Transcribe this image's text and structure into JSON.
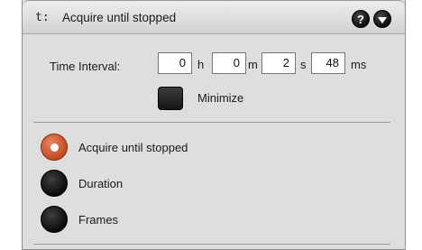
{
  "header": {
    "prefix": "t:",
    "title": "Acquire until stopped",
    "help_icon": "?",
    "collapse_icon": "chevron-down-icon"
  },
  "time_interval": {
    "label": "Time Interval:",
    "hours": "0",
    "hours_unit": "h",
    "minutes": "0",
    "minutes_unit": "m",
    "seconds": "2",
    "seconds_unit": "s",
    "milliseconds": "48",
    "milliseconds_unit": "ms"
  },
  "minimize": {
    "label": "Minimize",
    "checked": false
  },
  "mode": {
    "selected": "Acquire until stopped",
    "options": [
      {
        "label": "Acquire until stopped",
        "selected": true
      },
      {
        "label": "Duration",
        "selected": false
      },
      {
        "label": "Frames",
        "selected": false
      }
    ]
  },
  "colors": {
    "selected_radio": "#c9532b",
    "panel_background": "#dedede"
  }
}
